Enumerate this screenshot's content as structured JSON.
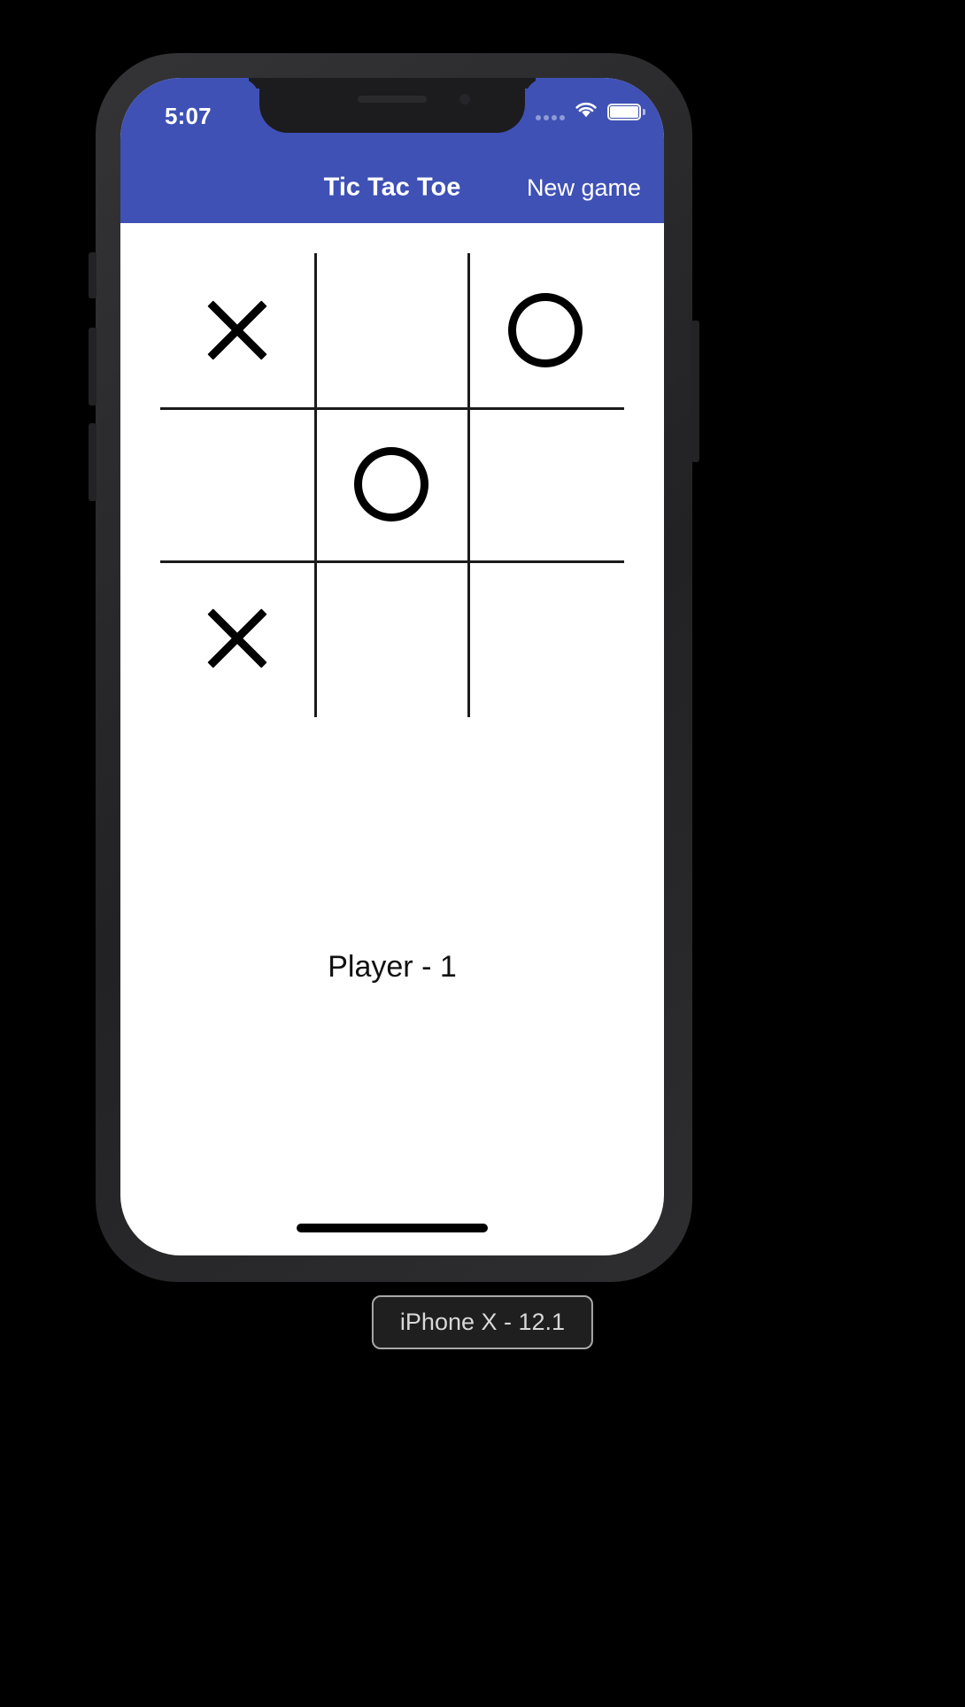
{
  "status_bar": {
    "time": "5:07",
    "cellular_icon": "cellular-dots-icon",
    "wifi_icon": "wifi-icon",
    "battery_icon": "battery-full-icon"
  },
  "app_bar": {
    "title": "Tic Tac Toe",
    "new_game_label": "New game",
    "background_color": "#3f51b5",
    "text_color": "#ffffff"
  },
  "board": {
    "rows": 3,
    "cols": 3,
    "line_color": "#1b1b1b",
    "cells": [
      {
        "index": 0,
        "row": 0,
        "col": 0,
        "mark": "X"
      },
      {
        "index": 1,
        "row": 0,
        "col": 1,
        "mark": ""
      },
      {
        "index": 2,
        "row": 0,
        "col": 2,
        "mark": "O"
      },
      {
        "index": 3,
        "row": 1,
        "col": 0,
        "mark": ""
      },
      {
        "index": 4,
        "row": 1,
        "col": 1,
        "mark": "O"
      },
      {
        "index": 5,
        "row": 1,
        "col": 2,
        "mark": ""
      },
      {
        "index": 6,
        "row": 2,
        "col": 0,
        "mark": "X"
      },
      {
        "index": 7,
        "row": 2,
        "col": 1,
        "mark": ""
      },
      {
        "index": 8,
        "row": 2,
        "col": 2,
        "mark": ""
      }
    ]
  },
  "status": {
    "player_text": "Player - 1"
  },
  "home_indicator": {
    "label": "home-indicator"
  },
  "device": {
    "label": "iPhone X - 12.1"
  },
  "colors": {
    "background": "#000000",
    "screen": "#ffffff",
    "accent": "#3f51b5",
    "mark": "#000000"
  }
}
